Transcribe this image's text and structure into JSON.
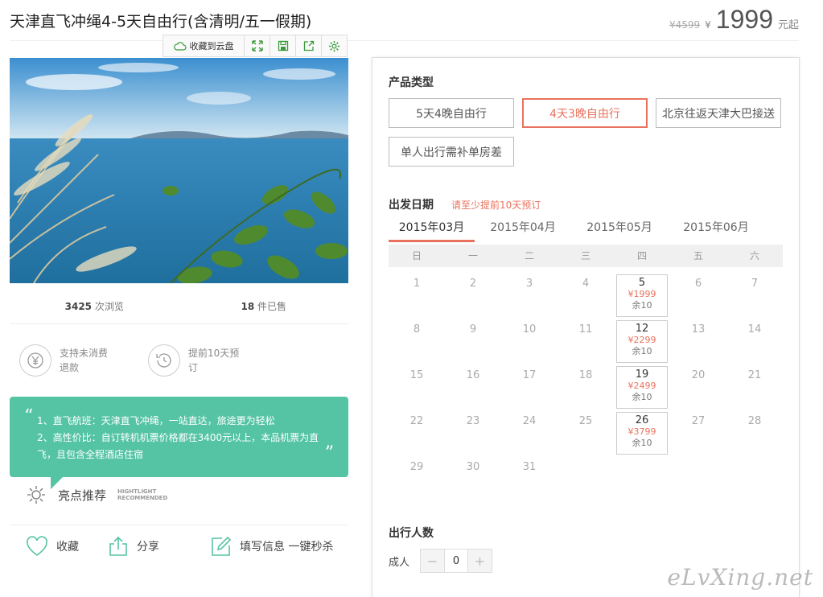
{
  "header": {
    "title": "天津直飞冲绳4-5天自由行(含清明/五一假期)",
    "old_price": "¥4599",
    "currency": "¥",
    "price": "1999",
    "price_suffix": "元起"
  },
  "toolbar": {
    "cloud_label": "收藏到云盘",
    "icons": [
      "cloud-icon",
      "expand-icon",
      "save-icon",
      "share-out-icon",
      "gear-icon"
    ]
  },
  "stats": {
    "views_count": "3425",
    "views_label": "次浏览",
    "sold_count": "18",
    "sold_label": "件已售"
  },
  "features": [
    {
      "icon": "yen-circle-icon",
      "label": "支持未消费退款"
    },
    {
      "icon": "clock-icon",
      "label": "提前10天预订"
    }
  ],
  "highlights": {
    "line1": "1、直飞航班：天津直飞冲绳，一站直达，旅途更为轻松",
    "line2": "2、高性价比：自订转机机票价格都在3400元以上，本品机票为直飞，且包含全程酒店住宿",
    "label": "亮点推荐",
    "label_en_1": "HIGHTLIGHT",
    "label_en_2": "RECOMMENDED"
  },
  "actions": {
    "favorite": "收藏",
    "share": "分享",
    "fill_info": "填写信息 一键秒杀"
  },
  "product": {
    "section_title": "产品类型",
    "options": [
      "5天4晚自由行",
      "4天3晚自由行",
      "北京往返天津大巴接送",
      "单人出行需补单房差"
    ],
    "selected_index": 1
  },
  "dates": {
    "section_title": "出发日期",
    "note": "请至少提前10天预订",
    "months": [
      "2015年03月",
      "2015年04月",
      "2015年05月",
      "2015年06月"
    ],
    "active_month_index": 0,
    "weekdays": [
      "日",
      "一",
      "二",
      "三",
      "四",
      "五",
      "六"
    ],
    "available": [
      {
        "day": "5",
        "price": "¥1999",
        "stock": "余10"
      },
      {
        "day": "12",
        "price": "¥2299",
        "stock": "余10"
      },
      {
        "day": "19",
        "price": "¥2499",
        "stock": "余10"
      },
      {
        "day": "26",
        "price": "¥3799",
        "stock": "余10"
      }
    ],
    "rows": [
      [
        "1",
        "2",
        "3",
        "4",
        "5",
        "6",
        "7"
      ],
      [
        "8",
        "9",
        "10",
        "11",
        "12",
        "13",
        "14"
      ],
      [
        "15",
        "16",
        "17",
        "18",
        "19",
        "20",
        "21"
      ],
      [
        "22",
        "23",
        "24",
        "25",
        "26",
        "27",
        "28"
      ],
      [
        "29",
        "30",
        "31",
        "",
        "",
        "",
        ""
      ]
    ]
  },
  "travelers": {
    "section_title": "出行人数",
    "adult_label": "成人",
    "adult_value": "0",
    "minus": "−",
    "plus": "+"
  },
  "watermark": "eLvXing.net",
  "colors": {
    "accent": "#e9725e",
    "green": "#55c4a4"
  }
}
